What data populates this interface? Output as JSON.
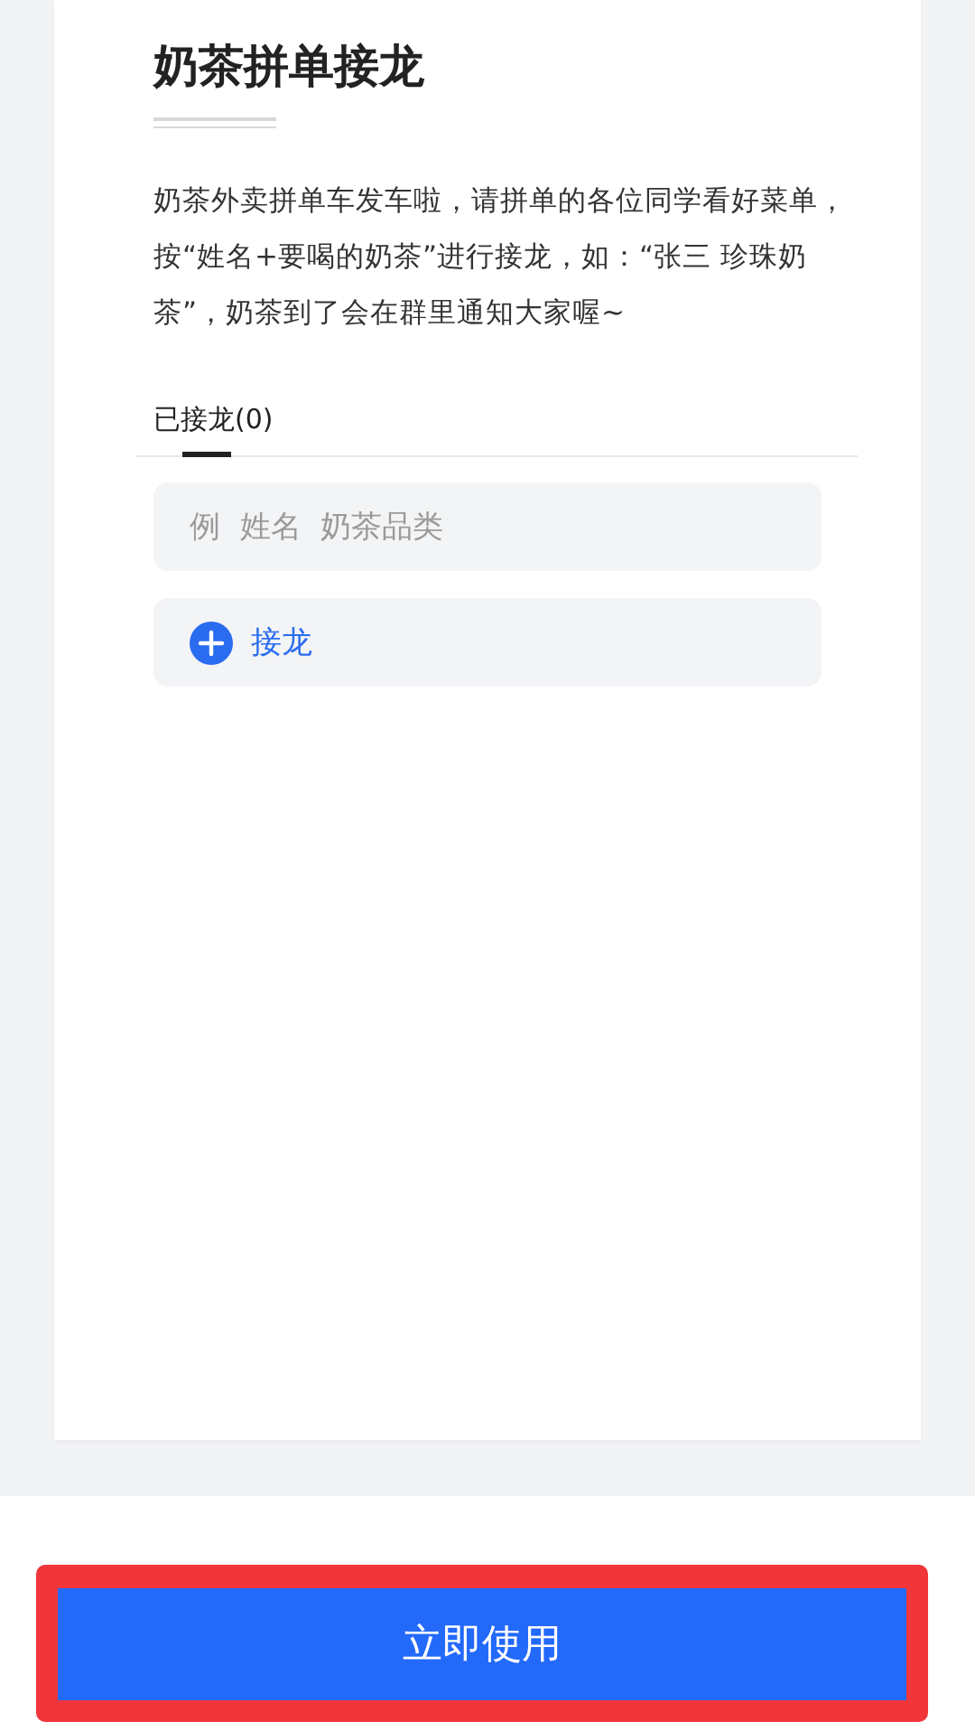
{
  "title": "奶茶拼单接龙",
  "description": "奶茶外卖拼单车发车啦，请拼单的各位同学看好菜单，按“姓名+要喝的奶茶”进行接龙，如：“张三 珍珠奶茶”，奶茶到了会在群里通知大家喔~",
  "tabs": [
    {
      "label": "已接龙(0)",
      "selected": true
    }
  ],
  "entry": {
    "placeholder": "例  姓名  奶茶品类"
  },
  "add_button": {
    "label": "接龙"
  },
  "footer": {
    "button": "立即使用",
    "highlighted": true
  }
}
